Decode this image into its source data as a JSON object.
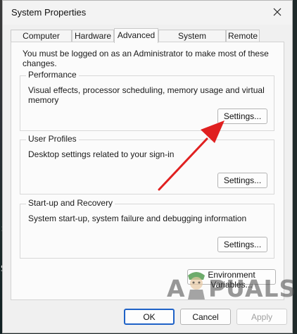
{
  "window": {
    "title": "System Properties"
  },
  "tabs": [
    {
      "label": "Computer Name"
    },
    {
      "label": "Hardware"
    },
    {
      "label": "Advanced"
    },
    {
      "label": "System Protection"
    },
    {
      "label": "Remote"
    }
  ],
  "active_tab": "Advanced",
  "note": "You must be logged on as an Administrator to make most of these changes.",
  "performance": {
    "title": "Performance",
    "description": "Visual effects, processor scheduling, memory usage and virtual memory",
    "button": "Settings..."
  },
  "user_profiles": {
    "title": "User Profiles",
    "description": "Desktop settings related to your sign-in",
    "button": "Settings..."
  },
  "startup_recovery": {
    "title": "Start-up and Recovery",
    "description": "System start-up, system failure and debugging information",
    "button": "Settings..."
  },
  "environment_button": "Environment Variables...",
  "footer": {
    "ok": "OK",
    "cancel": "Cancel",
    "apply": "Apply"
  },
  "watermark": {
    "a": "A",
    "rest": "PUALS"
  },
  "icons": {
    "close": "close-icon",
    "arrow": "red-arrow-annotation"
  },
  "colors": {
    "arrow": "#e02020",
    "primary_border": "#1f62c7"
  }
}
